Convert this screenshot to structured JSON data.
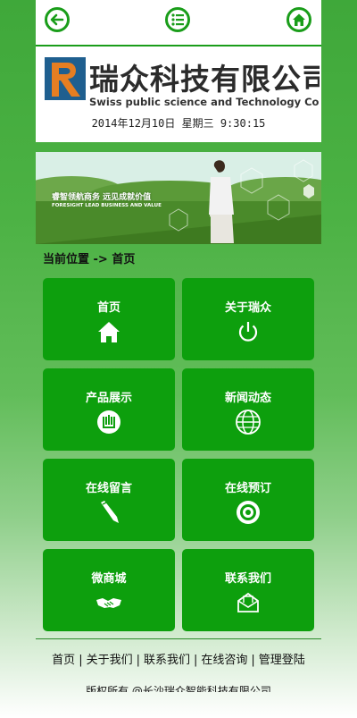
{
  "header": {
    "back_icon": "arrow-left-icon",
    "menu_icon": "list-menu-icon",
    "home_icon": "home-icon"
  },
  "logo": {
    "title": "瑞众科技有限公司",
    "subtitle": "Swiss public science and Technology Co Ltd"
  },
  "datetime": "2014年12月10日 星期三 9:30:15",
  "banner": {
    "slogan": "睿智领航商务 远见成就价值",
    "slogan_en": "FORESIGHT LEAD BUSINESS AND VALUE"
  },
  "breadcrumb": "当前位置 -> 首页",
  "tiles": [
    {
      "label": "首页",
      "icon": "home-icon"
    },
    {
      "label": "关于瑞众",
      "icon": "power-icon"
    },
    {
      "label": "产品展示",
      "icon": "product-icon"
    },
    {
      "label": "新闻动态",
      "icon": "globe-icon"
    },
    {
      "label": "在线留言",
      "icon": "pencil-icon"
    },
    {
      "label": "在线预订",
      "icon": "target-icon"
    },
    {
      "label": "微商城",
      "icon": "handshake-icon"
    },
    {
      "label": "联系我们",
      "icon": "envelope-icon"
    }
  ],
  "footer": {
    "links": [
      "首页",
      "关于我们",
      "联系我们",
      "在线咨询",
      "管理登陆"
    ],
    "separator": "|",
    "copyright": "版权所有 @长沙瑞众智能科技有限公司"
  },
  "colors": {
    "brand_green": "#0d9f0d",
    "icon_green": "#1a9d1a"
  }
}
